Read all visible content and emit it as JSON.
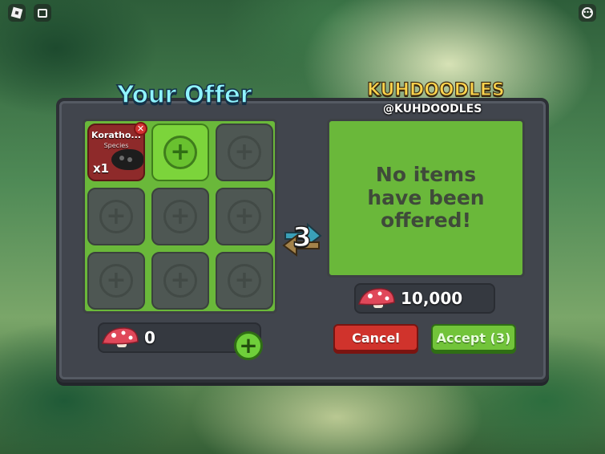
{
  "topbar": {
    "roblox_icon": "roblox-logo-icon",
    "chat_icon": "chat-icon",
    "menu_icon": "menu-icon"
  },
  "your_offer": {
    "title": "Your Offer",
    "items": [
      {
        "name": "Koratho...",
        "sub": "Species",
        "qty": "x1"
      }
    ],
    "currency_value": "0"
  },
  "their_offer": {
    "name": "KUHDOODLES",
    "handle": "@KUHDOODLES",
    "empty_text": "No items have been offered!",
    "currency_value": "10,000"
  },
  "trade": {
    "countdown": "3"
  },
  "buttons": {
    "cancel": "Cancel",
    "accept": "Accept (3)"
  },
  "colors": {
    "offer_green": "#6ab83a",
    "cancel_red": "#d0332c",
    "accept_green": "#72c43a",
    "title_cyan": "#8ff4ff",
    "name_gold": "#ffd54d"
  }
}
